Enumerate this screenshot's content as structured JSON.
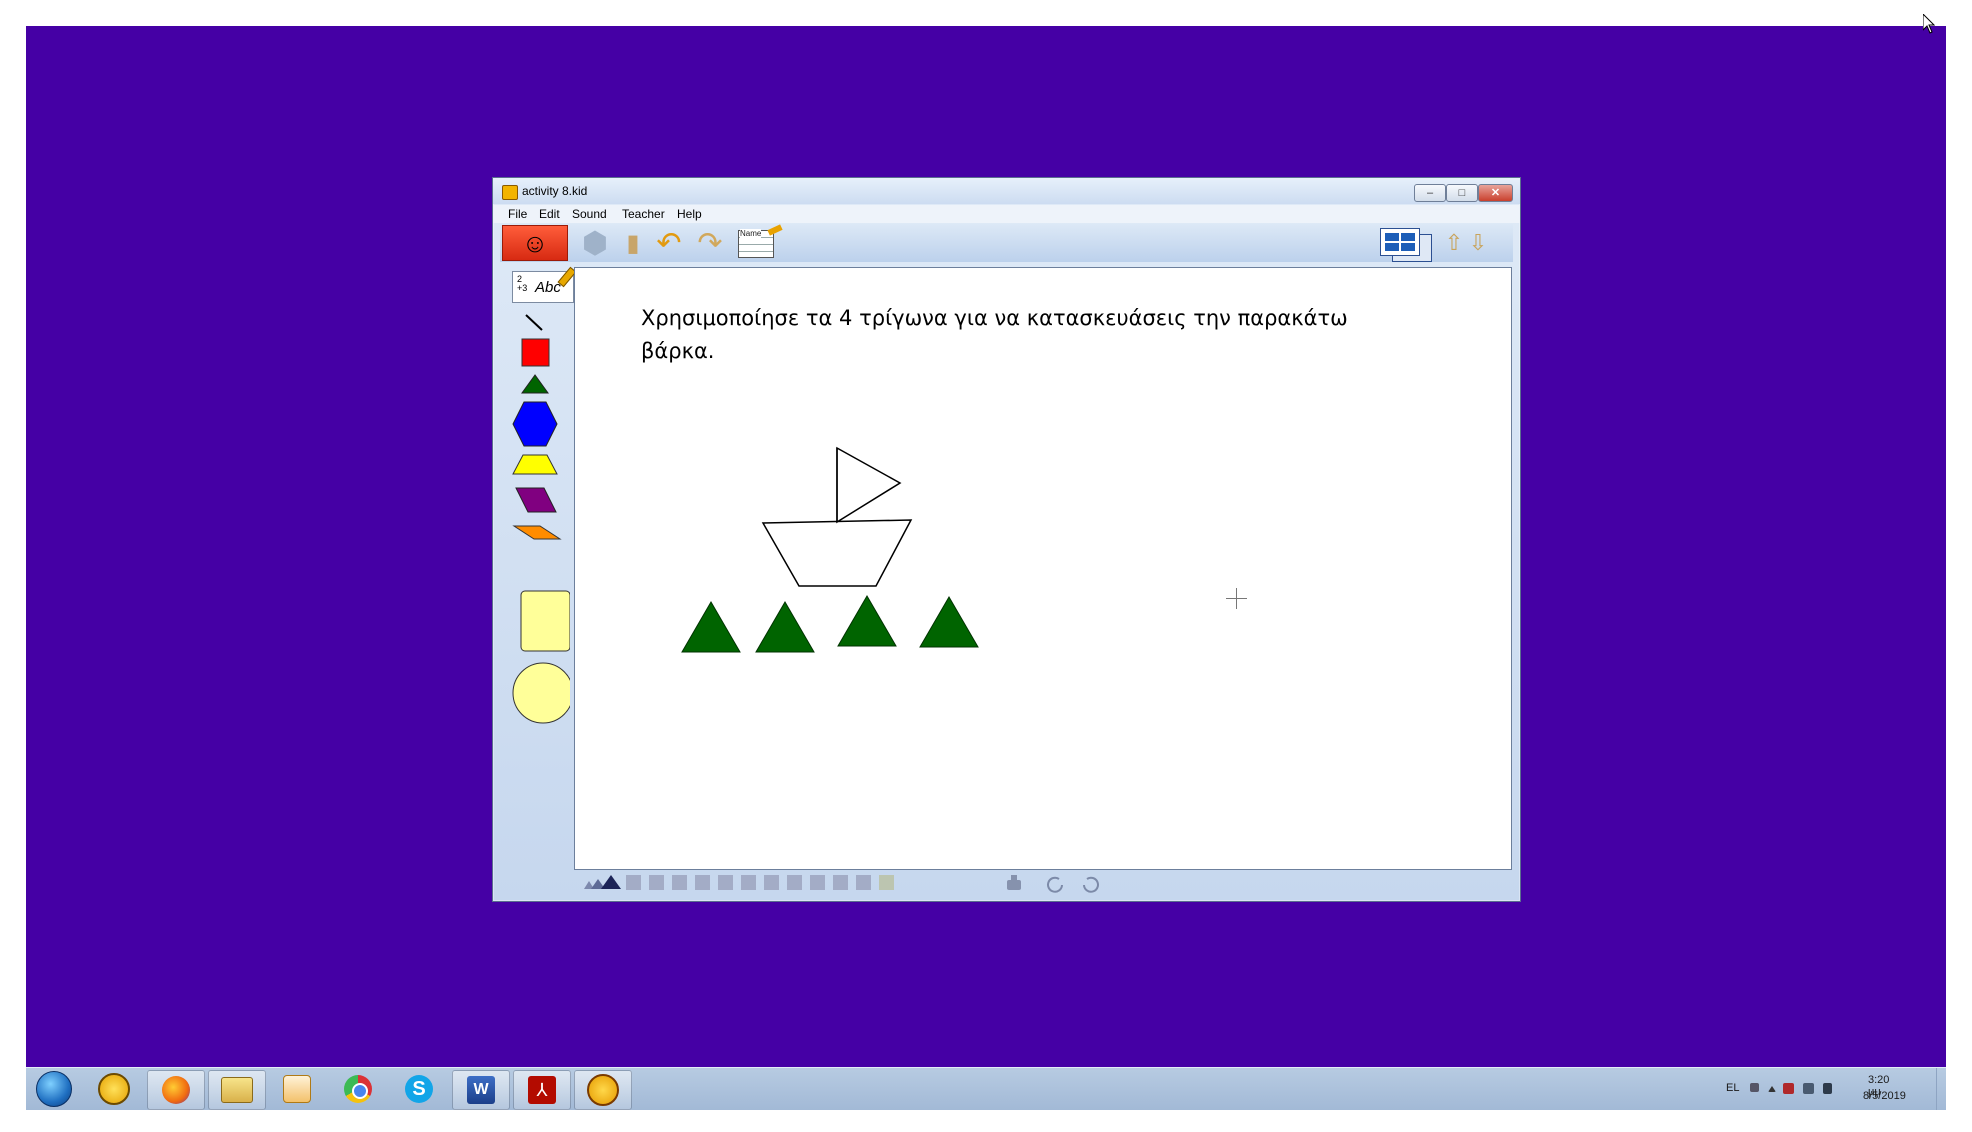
{
  "window": {
    "title": "activity 8.kid",
    "controls": {
      "minimize": "–",
      "maximize": "□",
      "close": "✕"
    }
  },
  "menu": [
    "File",
    "Edit",
    "Sound",
    "Teacher",
    "Help"
  ],
  "toolbar": {
    "name_label": "Name",
    "icons": [
      "kid-pix-logo-icon",
      "pieces-icon",
      "eraser-icon",
      "undo-icon",
      "redo-icon",
      "name-card-icon",
      "view-toggle-icon",
      "arrow-up-icon",
      "arrow-down-icon"
    ]
  },
  "palette": {
    "text_tool_numbers": "2\n+3",
    "text_tool_label": "Abc",
    "shapes": [
      {
        "name": "line",
        "color": "#000000"
      },
      {
        "name": "square",
        "color": "#ff0000"
      },
      {
        "name": "triangle",
        "color": "#006400"
      },
      {
        "name": "hexagon",
        "color": "#0000ff"
      },
      {
        "name": "trapezoid",
        "color": "#ffff00"
      },
      {
        "name": "rhombus",
        "color": "#800080"
      },
      {
        "name": "thin-rhombus",
        "color": "#ff8c00"
      },
      {
        "name": "rectangle",
        "color": "#ffff99"
      },
      {
        "name": "circle",
        "color": "#ffff99"
      }
    ]
  },
  "canvas": {
    "instruction": "Χρησιμοποίησε τα 4 τρίγωνα για να κατασκευάσεις την παρακάτω βάρκα.",
    "triangle_color": "#006400",
    "triangle_count": 4
  },
  "taskbar": {
    "apps": [
      "windows-start-icon",
      "app-icon",
      "firefox-icon",
      "file-explorer-icon",
      "media-player-icon",
      "chrome-icon",
      "skype-icon",
      "word-icon",
      "acrobat-icon",
      "kid-pix-icon"
    ],
    "skype_letter": "S",
    "word_letter": "W",
    "language": "EL",
    "time": "3:20 μμ",
    "date": "8/5/2019"
  },
  "colors": {
    "desktop": "#4500a5",
    "window_chrome": "#c6d7ee",
    "canvas": "#ffffff"
  }
}
